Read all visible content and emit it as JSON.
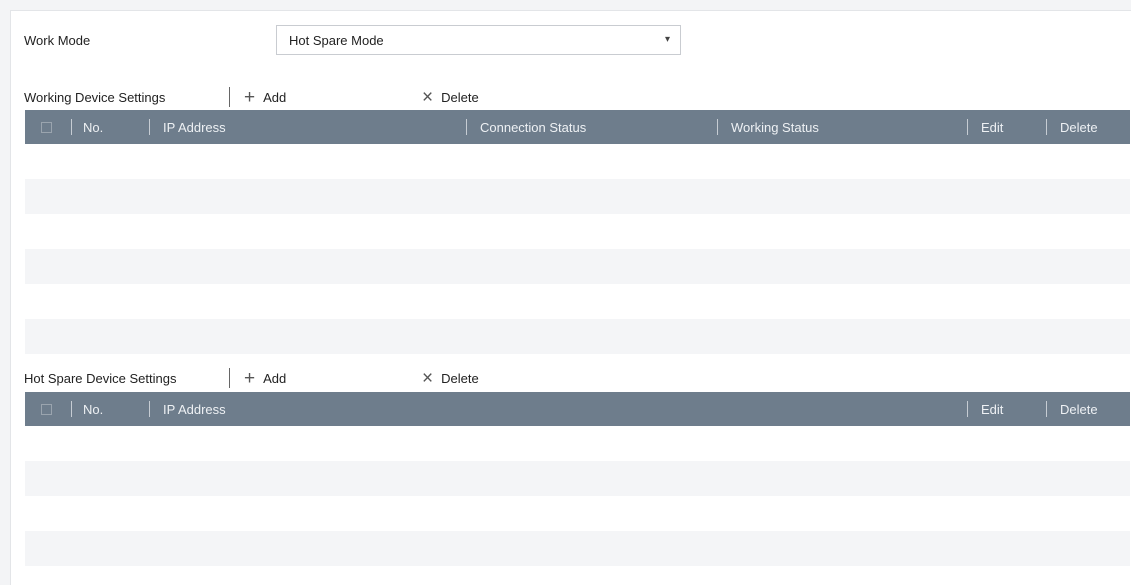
{
  "work_mode": {
    "label": "Work Mode",
    "selected": "Hot Spare Mode"
  },
  "working_device": {
    "title": "Working Device Settings",
    "add_label": "Add",
    "delete_label": "Delete",
    "columns": {
      "no": "No.",
      "ip": "IP Address",
      "connection": "Connection Status",
      "working": "Working Status",
      "edit": "Edit",
      "delete": "Delete"
    },
    "rows": []
  },
  "hot_spare_device": {
    "title": "Hot Spare Device Settings",
    "add_label": "Add",
    "delete_label": "Delete",
    "columns": {
      "no": "No.",
      "ip": "IP Address",
      "edit": "Edit",
      "delete": "Delete"
    },
    "rows": []
  },
  "colors": {
    "header_bg": "#6e7d8c",
    "row_alt_bg": "#f4f5f7"
  }
}
